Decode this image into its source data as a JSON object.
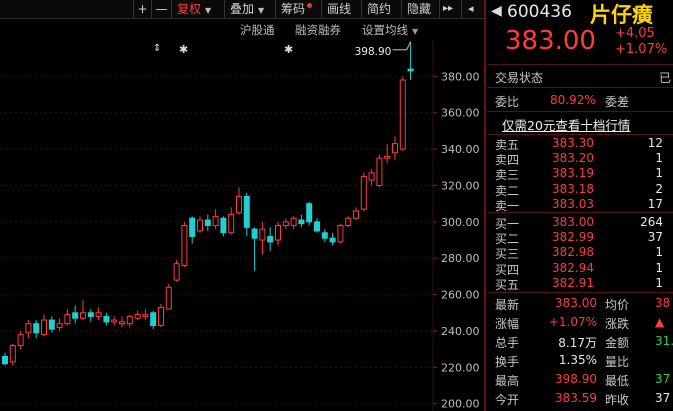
{
  "toolbar": {
    "plus": "+",
    "minus": "—",
    "fuquan": "复权",
    "diejia": "叠加",
    "chouma": "筹码",
    "huaxian": "画线",
    "jianyue": "简约",
    "yincang": "隐藏",
    "expand": "▸▸",
    "collapse": "◂"
  },
  "subbar": {
    "hugutong": "沪股通",
    "rongzi": "融资融券",
    "settings": "设置均线"
  },
  "chart_data": {
    "type": "candlestick",
    "y_ticks": [
      "380.00",
      "360.00",
      "340.00",
      "320.00",
      "300.00",
      "280.00",
      "260.00",
      "240.00",
      "220.00",
      "200.00"
    ],
    "ylim": [
      196,
      400
    ],
    "high_annotation": "398.90",
    "candles": [
      {
        "o": 226,
        "c": 222,
        "h": 228,
        "l": 221
      },
      {
        "o": 223,
        "c": 232,
        "h": 233,
        "l": 221
      },
      {
        "o": 232,
        "c": 238,
        "h": 240,
        "l": 230
      },
      {
        "o": 239,
        "c": 244,
        "h": 246,
        "l": 236
      },
      {
        "o": 244,
        "c": 239,
        "h": 246,
        "l": 236
      },
      {
        "o": 238,
        "c": 246,
        "h": 249,
        "l": 237
      },
      {
        "o": 246,
        "c": 241,
        "h": 248,
        "l": 239
      },
      {
        "o": 242,
        "c": 244,
        "h": 247,
        "l": 240
      },
      {
        "o": 244,
        "c": 249,
        "h": 252,
        "l": 243
      },
      {
        "o": 250,
        "c": 247,
        "h": 254,
        "l": 244
      },
      {
        "o": 247,
        "c": 250,
        "h": 257,
        "l": 246
      },
      {
        "o": 250,
        "c": 248,
        "h": 252,
        "l": 245
      },
      {
        "o": 248,
        "c": 250,
        "h": 253,
        "l": 246
      },
      {
        "o": 248,
        "c": 245,
        "h": 250,
        "l": 243
      },
      {
        "o": 245,
        "c": 246,
        "h": 248,
        "l": 243
      },
      {
        "o": 244,
        "c": 245,
        "h": 248,
        "l": 242
      },
      {
        "o": 244,
        "c": 248,
        "h": 249,
        "l": 242
      },
      {
        "o": 247,
        "c": 249,
        "h": 251,
        "l": 246
      },
      {
        "o": 248,
        "c": 249,
        "h": 252,
        "l": 246
      },
      {
        "o": 250,
        "c": 243,
        "h": 251,
        "l": 241
      },
      {
        "o": 243,
        "c": 253,
        "h": 255,
        "l": 242
      },
      {
        "o": 252,
        "c": 264,
        "h": 266,
        "l": 252
      },
      {
        "o": 268,
        "c": 277,
        "h": 279,
        "l": 267
      },
      {
        "o": 276,
        "c": 298,
        "h": 300,
        "l": 275
      },
      {
        "o": 302,
        "c": 292,
        "h": 303,
        "l": 288
      },
      {
        "o": 295,
        "c": 301,
        "h": 303,
        "l": 294
      },
      {
        "o": 301,
        "c": 298,
        "h": 304,
        "l": 295
      },
      {
        "o": 298,
        "c": 303,
        "h": 307,
        "l": 296
      },
      {
        "o": 302,
        "c": 294,
        "h": 303,
        "l": 292
      },
      {
        "o": 294,
        "c": 304,
        "h": 308,
        "l": 293
      },
      {
        "o": 305,
        "c": 314,
        "h": 319,
        "l": 304
      },
      {
        "o": 314,
        "c": 297,
        "h": 316,
        "l": 292
      },
      {
        "o": 296,
        "c": 291,
        "h": 297,
        "l": 273
      },
      {
        "o": 290,
        "c": 296,
        "h": 300,
        "l": 282
      },
      {
        "o": 292,
        "c": 289,
        "h": 297,
        "l": 284
      },
      {
        "o": 290,
        "c": 298,
        "h": 300,
        "l": 287
      },
      {
        "o": 298,
        "c": 300,
        "h": 302,
        "l": 296
      },
      {
        "o": 298,
        "c": 302,
        "h": 303,
        "l": 296
      },
      {
        "o": 301,
        "c": 299,
        "h": 304,
        "l": 297
      },
      {
        "o": 310,
        "c": 300,
        "h": 311,
        "l": 298
      },
      {
        "o": 300,
        "c": 295,
        "h": 302,
        "l": 294
      },
      {
        "o": 294,
        "c": 291,
        "h": 296,
        "l": 289
      },
      {
        "o": 291,
        "c": 289,
        "h": 294,
        "l": 287
      },
      {
        "o": 289,
        "c": 298,
        "h": 299,
        "l": 288
      },
      {
        "o": 298,
        "c": 302,
        "h": 303,
        "l": 297
      },
      {
        "o": 302,
        "c": 306,
        "h": 308,
        "l": 301
      },
      {
        "o": 307,
        "c": 325,
        "h": 327,
        "l": 306
      },
      {
        "o": 323,
        "c": 327,
        "h": 329,
        "l": 320
      },
      {
        "o": 320,
        "c": 335,
        "h": 337,
        "l": 319
      },
      {
        "o": 335,
        "c": 336,
        "h": 343,
        "l": 332
      },
      {
        "o": 338,
        "c": 343,
        "h": 347,
        "l": 334
      },
      {
        "o": 340,
        "c": 378,
        "h": 380,
        "l": 339
      },
      {
        "o": 384,
        "c": 383,
        "h": 399,
        "l": 378
      }
    ]
  },
  "quote": {
    "code": "600436",
    "name": "片仔癀",
    "price": "383.00",
    "change": "+4.05",
    "change_pct": "+1.07%",
    "status_label": "交易状态",
    "status_value": "已",
    "weibi_label": "委比",
    "weibi_value": "80.92%",
    "weicha_label": "委差",
    "link_text": "仅需20元查看十档行情"
  },
  "sell": [
    {
      "label": "卖五",
      "price": "383.30",
      "vol": "12"
    },
    {
      "label": "卖四",
      "price": "383.20",
      "vol": "1"
    },
    {
      "label": "卖三",
      "price": "383.19",
      "vol": "1"
    },
    {
      "label": "卖二",
      "price": "383.18",
      "vol": "2"
    },
    {
      "label": "卖一",
      "price": "383.03",
      "vol": "17"
    }
  ],
  "buy": [
    {
      "label": "买一",
      "price": "383.00",
      "vol": "264"
    },
    {
      "label": "买二",
      "price": "382.99",
      "vol": "37"
    },
    {
      "label": "买三",
      "price": "382.98",
      "vol": "1"
    },
    {
      "label": "买四",
      "price": "382.94",
      "vol": "1"
    },
    {
      "label": "买五",
      "price": "382.91",
      "vol": "1"
    }
  ],
  "stats": [
    {
      "label": "最新",
      "value": "383.00",
      "label2": "均价",
      "value2": "38"
    },
    {
      "label": "涨幅",
      "value": "+1.07%",
      "label2": "涨跌",
      "value2": "▲"
    },
    {
      "label": "总手",
      "value": "8.17万",
      "label2": "金额",
      "value2": "31."
    },
    {
      "label": "换手",
      "value": "1.35%",
      "label2": "量比",
      "value2": ""
    },
    {
      "label": "最高",
      "value": "398.90",
      "label2": "最低",
      "value2": "37"
    },
    {
      "label": "今开",
      "value": "383.59",
      "label2": "昨收",
      "value2": "37"
    }
  ],
  "colors": {
    "up": "#ff3b3b",
    "down": "#20d0d0",
    "grid": "#3a0d0d"
  }
}
